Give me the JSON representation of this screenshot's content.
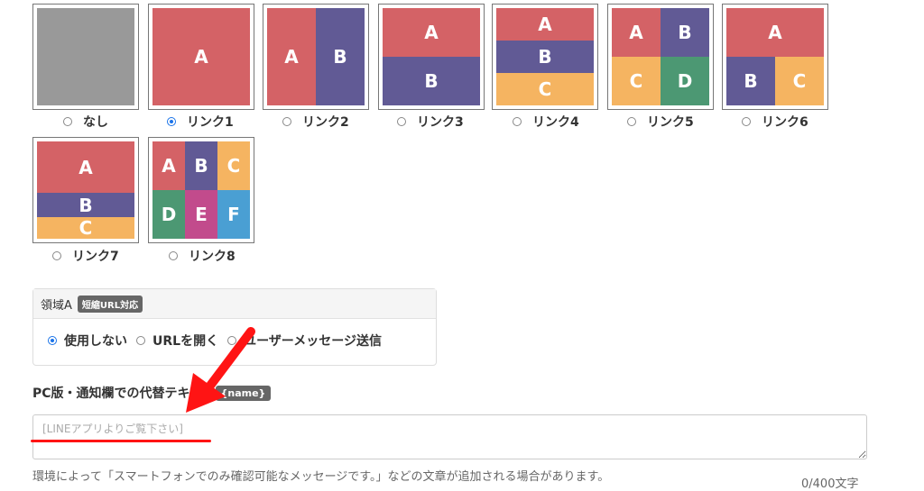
{
  "layouts": {
    "row1": [
      {
        "label": "なし",
        "selected": false
      },
      {
        "label": "リンク1",
        "selected": true
      },
      {
        "label": "リンク2",
        "selected": false
      },
      {
        "label": "リンク3",
        "selected": false
      },
      {
        "label": "リンク4",
        "selected": false
      },
      {
        "label": "リンク5",
        "selected": false
      },
      {
        "label": "リンク6",
        "selected": false
      }
    ],
    "row2": [
      {
        "label": "リンク7",
        "selected": false
      },
      {
        "label": "リンク8",
        "selected": false
      }
    ],
    "cell_letters": [
      "A",
      "B",
      "C",
      "D",
      "E",
      "F"
    ]
  },
  "colors": {
    "none": "#999999",
    "red": "#d46266",
    "purple": "#615a95",
    "orange": "#f5b461",
    "green": "#4c9873",
    "magenta": "#c24b8c",
    "blue": "#4a9fd3",
    "accent": "#1a73e8",
    "annotation": "#ff1414"
  },
  "region": {
    "title": "領域A",
    "badge": "短縮URL対応",
    "options": [
      {
        "label": "使用しない",
        "selected": true
      },
      {
        "label": "URLを開く",
        "selected": false
      },
      {
        "label": "ユーザーメッセージ送信",
        "selected": false
      }
    ]
  },
  "alt_text": {
    "label": "PC版・通知欄での代替テキ",
    "badge": "{name}",
    "placeholder": "[LINEアプリよりご覧下さい]"
  },
  "footer": {
    "note": "環境によって「スマートフォンでのみ確認可能なメッセージです。」などの文章が追加される場合があります。",
    "counter": "0/400文字"
  }
}
